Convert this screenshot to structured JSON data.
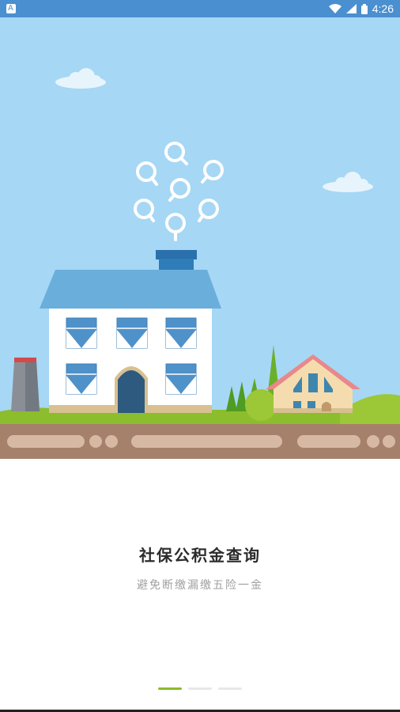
{
  "status_bar": {
    "time": "4:26",
    "notification_icon": "a-notification-icon",
    "wifi_icon": "wifi-icon",
    "signal_icon": "signal-icon",
    "battery_icon": "battery-icon"
  },
  "illustration": {
    "icons": [
      "search-bubble-icon"
    ]
  },
  "onboarding": {
    "title": "社保公积金查询",
    "subtitle": "避免断缴漏缴五险一金"
  },
  "pager": {
    "total": 3,
    "active_index": 0
  },
  "colors": {
    "sky": "#a6d7f5",
    "status_bar": "#4a8fd0",
    "accent": "#8cbb2a",
    "road": "#a5806b"
  }
}
